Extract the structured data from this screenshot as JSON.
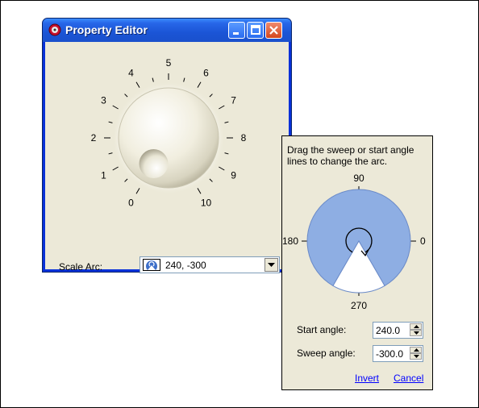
{
  "window": {
    "title": "Property Editor",
    "knob": {
      "scale_labels": [
        "0",
        "1",
        "2",
        "3",
        "4",
        "5",
        "6",
        "7",
        "8",
        "9",
        "10"
      ],
      "scale_min": 0,
      "scale_max": 10,
      "value": 0,
      "colors": {
        "face": "#f4f1e3",
        "shadow": "#b8b39e"
      }
    },
    "scale_arc": {
      "label": "Scale Arc:",
      "value": "240, -300"
    }
  },
  "popup": {
    "instructions": "Drag the sweep or start angle lines to change the arc.",
    "angle_labels": {
      "top": "90",
      "left": "180",
      "right": "0",
      "bottom": "270"
    },
    "start_angle": {
      "label": "Start angle:",
      "value": "240.0"
    },
    "sweep_angle": {
      "label": "Sweep angle:",
      "value": "-300.0"
    },
    "invert_label": "Invert",
    "cancel_label": "Cancel",
    "colors": {
      "arc_fill": "#8eaee3",
      "gap_fill": "#ffffff",
      "arrow": "#000000"
    }
  }
}
